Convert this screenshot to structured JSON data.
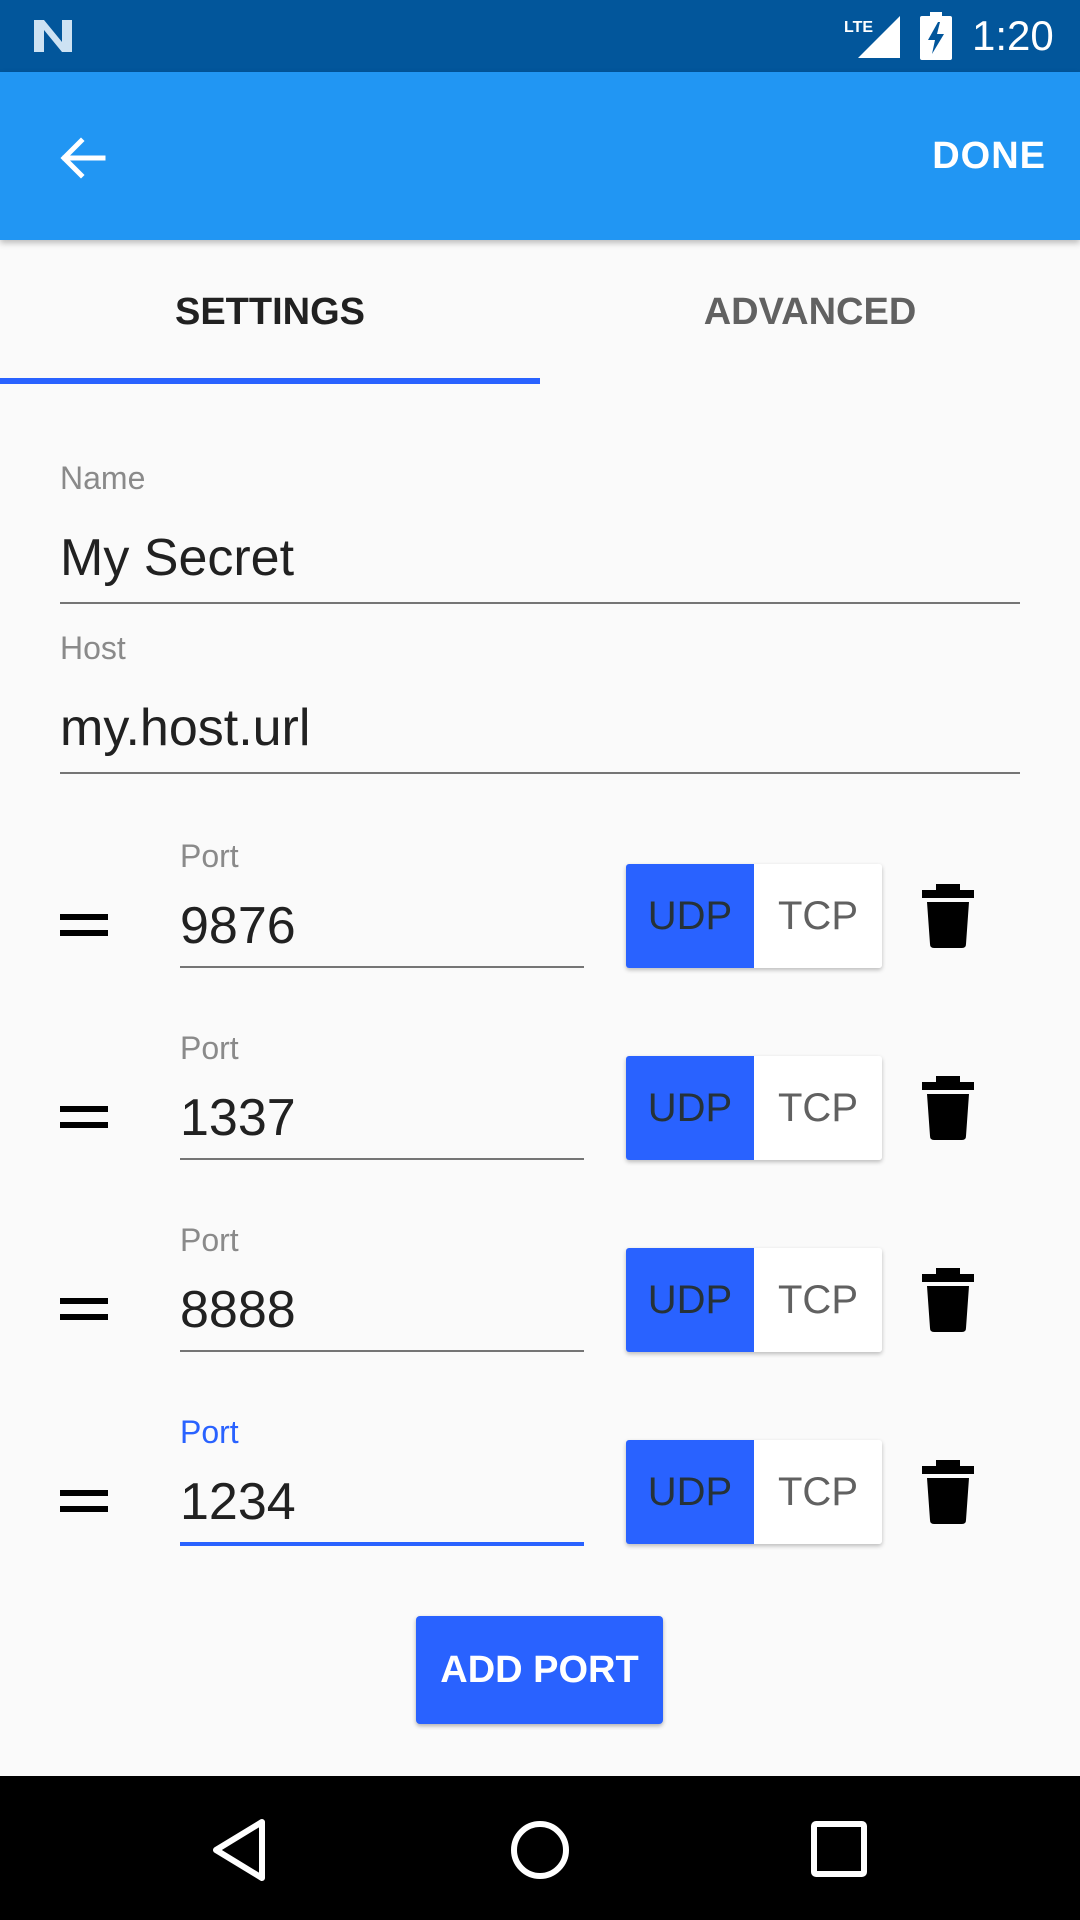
{
  "status_bar": {
    "network_label": "LTE",
    "time": "1:20",
    "icons": [
      "n-logo-icon",
      "lte-signal-icon",
      "battery-charging-icon"
    ]
  },
  "app_bar": {
    "back_icon": "arrow-back-icon",
    "done_label": "DONE",
    "color": "#2196f3"
  },
  "tabs": [
    {
      "label": "SETTINGS",
      "selected": true
    },
    {
      "label": "ADVANCED",
      "selected": false
    }
  ],
  "form": {
    "name": {
      "label": "Name",
      "value": "My Secret"
    },
    "host": {
      "label": "Host",
      "value": "my.host.url"
    }
  },
  "ports": [
    {
      "label": "Port",
      "value": "9876",
      "protocol_options": [
        "UDP",
        "TCP"
      ],
      "selected_protocol": "UDP",
      "focused": false
    },
    {
      "label": "Port",
      "value": "1337",
      "protocol_options": [
        "UDP",
        "TCP"
      ],
      "selected_protocol": "UDP",
      "focused": false
    },
    {
      "label": "Port",
      "value": "8888",
      "protocol_options": [
        "UDP",
        "TCP"
      ],
      "selected_protocol": "UDP",
      "focused": false
    },
    {
      "label": "Port",
      "value": "1234",
      "protocol_options": [
        "UDP",
        "TCP"
      ],
      "selected_protocol": "UDP",
      "focused": true
    }
  ],
  "add_port_label": "ADD PORT",
  "nav_bar": {
    "icons": [
      "back-triangle-icon",
      "home-circle-icon",
      "recents-square-icon"
    ]
  },
  "colors": {
    "status_bar": "#02569b",
    "accent": "#2962ff",
    "nav_bar": "#000000"
  }
}
